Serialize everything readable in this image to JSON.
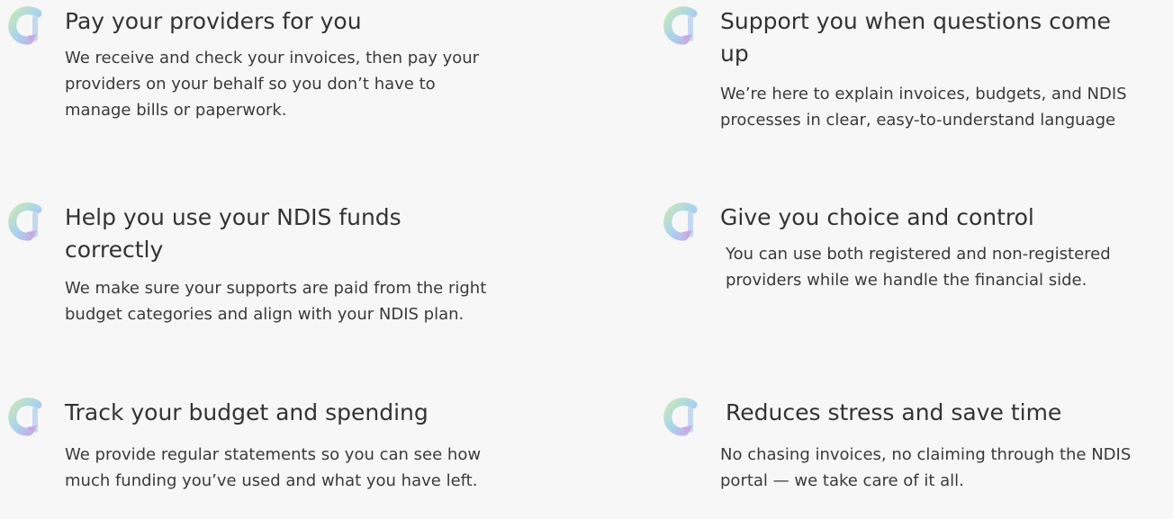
{
  "features": [
    {
      "icon": "refresh-arrow-icon",
      "title": "Pay your providers for you",
      "description": "We receive and check your invoices, then pay your providers on your behalf so you don’t have to manage bills or paperwork."
    },
    {
      "icon": "refresh-arrow-icon",
      "title": "Help you use your NDIS funds correctly",
      "description": "We make sure your supports are paid from the right budget categories and align with your NDIS plan."
    },
    {
      "icon": "refresh-arrow-icon",
      "title": "Track your budget and spending",
      "description": "We provide regular statements so you can see how much funding you’ve used and what you have left."
    },
    {
      "icon": "refresh-arrow-icon",
      "title": "Support you when questions come up",
      "description": "We’re here to explain invoices, budgets, and NDIS processes in clear, easy-to-understand language"
    },
    {
      "icon": "refresh-arrow-icon",
      "title": "Give you choice and control",
      "description": "You can use both registered and non-registered providers while we handle the financial side."
    },
    {
      "icon": "refresh-arrow-icon",
      "title": "Reduces stress and save time",
      "description": "No chasing invoices, no claiming through the NDIS portal — we take care of it all."
    }
  ],
  "colors": {
    "icon_green": "#c9e7b6",
    "icon_blue": "#a9d4ef",
    "icon_purple": "#c9a9e3",
    "background": "#f7f7f7"
  }
}
